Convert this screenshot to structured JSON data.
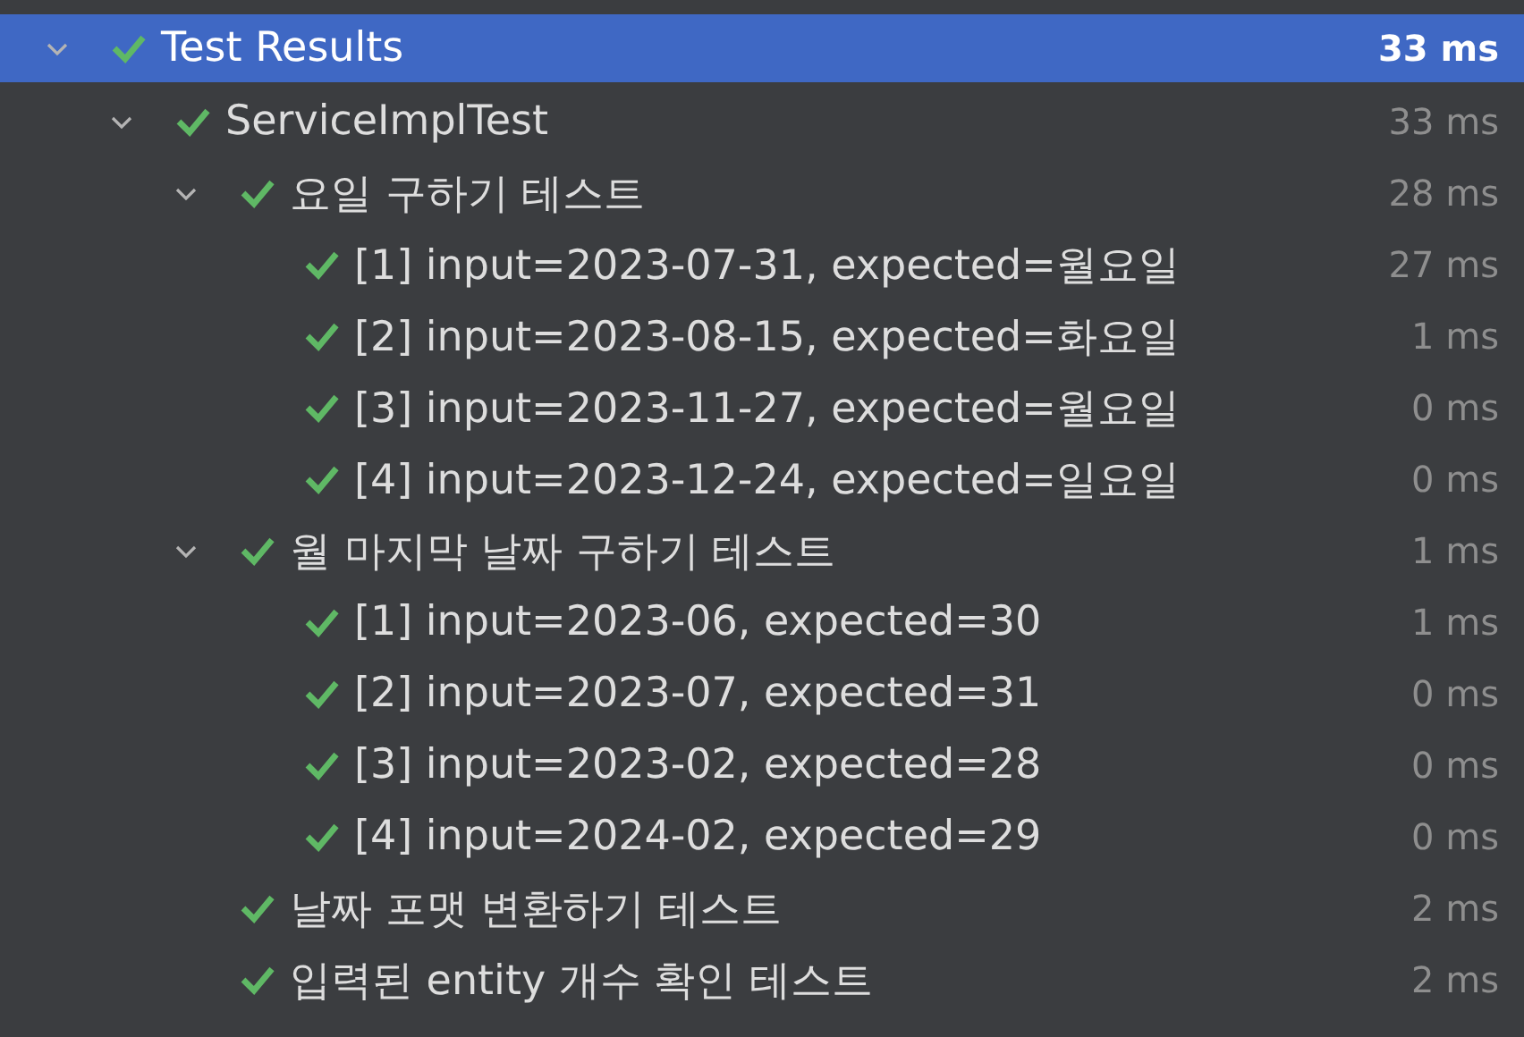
{
  "tree": [
    {
      "label": "Test Results",
      "time": "33 ms",
      "kind": "passed",
      "selected": true,
      "expanded": true,
      "children": [
        {
          "label": "ServiceImplTest",
          "time": "33 ms",
          "kind": "passed",
          "selected": false,
          "expanded": true,
          "children": [
            {
              "label": "요일 구하기 테스트",
              "time": "28 ms",
              "kind": "passed",
              "selected": false,
              "expanded": true,
              "children": [
                {
                  "label": "[1] input=2023-07-31, expected=월요일",
                  "time": "27 ms",
                  "kind": "passed",
                  "selected": false
                },
                {
                  "label": "[2] input=2023-08-15, expected=화요일",
                  "time": "1 ms",
                  "kind": "passed",
                  "selected": false
                },
                {
                  "label": "[3] input=2023-11-27, expected=월요일",
                  "time": "0 ms",
                  "kind": "passed",
                  "selected": false
                },
                {
                  "label": "[4] input=2023-12-24, expected=일요일",
                  "time": "0 ms",
                  "kind": "passed",
                  "selected": false
                }
              ]
            },
            {
              "label": "월 마지막 날짜 구하기 테스트",
              "time": "1 ms",
              "kind": "passed",
              "selected": false,
              "expanded": true,
              "children": [
                {
                  "label": "[1] input=2023-06, expected=30",
                  "time": "1 ms",
                  "kind": "passed",
                  "selected": false
                },
                {
                  "label": "[2] input=2023-07, expected=31",
                  "time": "0 ms",
                  "kind": "passed",
                  "selected": false
                },
                {
                  "label": "[3] input=2023-02, expected=28",
                  "time": "0 ms",
                  "kind": "passed",
                  "selected": false
                },
                {
                  "label": "[4] input=2024-02, expected=29",
                  "time": "0 ms",
                  "kind": "passed",
                  "selected": false
                }
              ]
            },
            {
              "label": "날짜 포맷 변환하기 테스트",
              "time": "2 ms",
              "kind": "passed",
              "selected": false
            },
            {
              "label": "입력된 entity 개수 확인 테스트",
              "time": "2 ms",
              "kind": "passed",
              "selected": false
            }
          ]
        }
      ]
    }
  ]
}
